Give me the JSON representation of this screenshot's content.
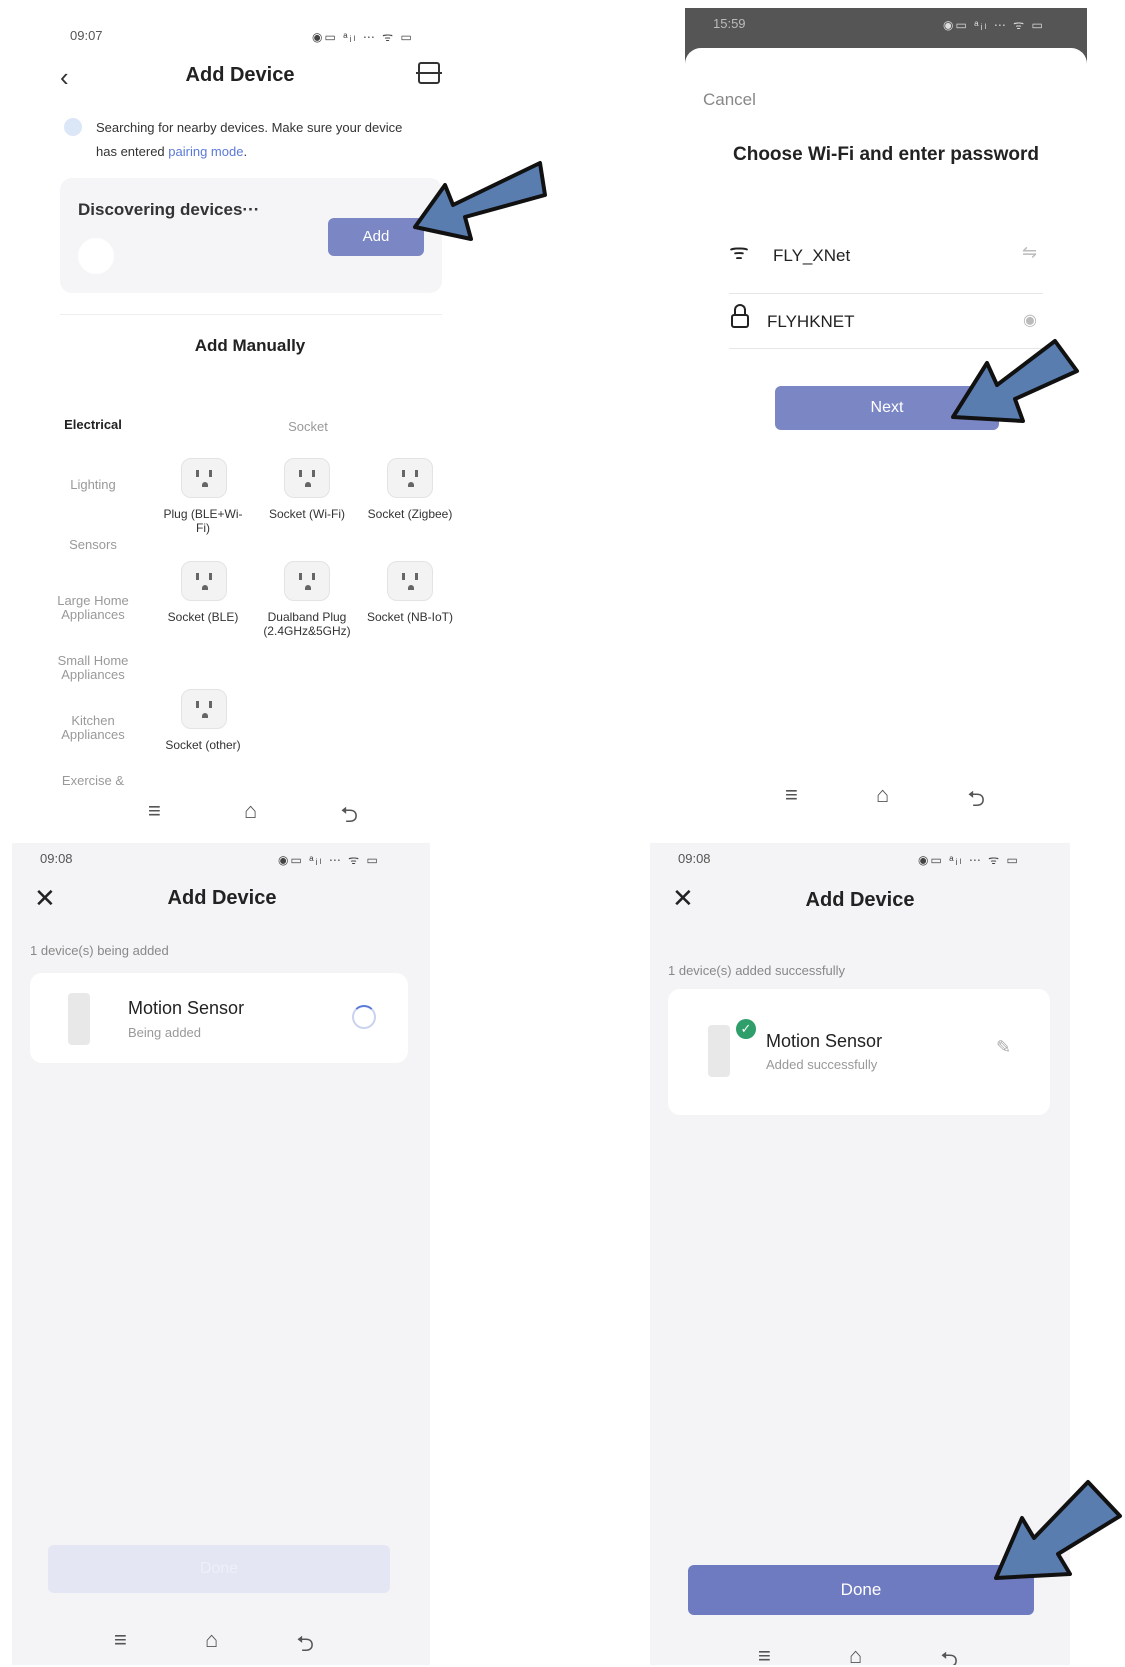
{
  "panel1": {
    "time": "09:07",
    "title": "Add Device",
    "search_text": "Searching for nearby devices. Make sure your device has entered",
    "pairing_link": "pairing mode",
    "search_text_end": ".",
    "discovering": "Discovering devices···",
    "add_button": "Add",
    "add_manually": "Add Manually",
    "categories": [
      "Electrical",
      "Lighting",
      "Sensors",
      "Large Home Appliances",
      "Small Home Appliances",
      "Kitchen Appliances",
      "Exercise &"
    ],
    "category_header": "Socket",
    "devices": [
      "Plug (BLE+Wi-Fi)",
      "Socket (Wi-Fi)",
      "Socket (Zigbee)",
      "Socket (BLE)",
      "Dualband Plug (2.4GHz&5GHz)",
      "Socket (NB-IoT)",
      "Socket (other)"
    ]
  },
  "panel2": {
    "time": "15:59",
    "cancel": "Cancel",
    "title": "Choose Wi-Fi and enter password",
    "ssid": "FLY_XNet",
    "password": "FLYHKNET",
    "next_button": "Next"
  },
  "panel3": {
    "time": "09:08",
    "title": "Add Device",
    "status": "1 device(s) being added",
    "device_name": "Motion Sensor",
    "device_status": "Being added",
    "done_button": "Done"
  },
  "panel4": {
    "time": "09:08",
    "title": "Add Device",
    "status": "1 device(s) added successfully",
    "device_name": "Motion Sensor",
    "device_status": "Added successfully",
    "done_button": "Done"
  },
  "colors": {
    "accent": "#7b86c4",
    "link": "#5b79d6",
    "arrow": "#5a7db0",
    "success": "#2f9e6a"
  }
}
